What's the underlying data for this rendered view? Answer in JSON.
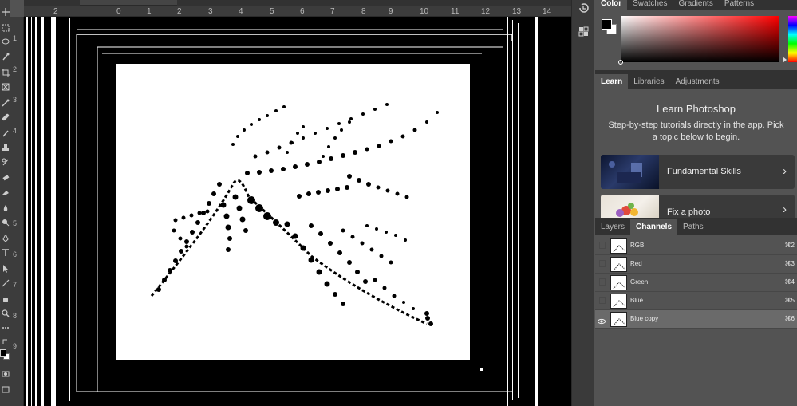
{
  "ruler_top": {
    "labels": [
      "2",
      "0",
      "1",
      "2",
      "3",
      "4",
      "5",
      "6",
      "7",
      "8",
      "9",
      "10",
      "11",
      "12",
      "13",
      "14"
    ]
  },
  "ruler_left": {
    "labels": [
      "1",
      "2",
      "3",
      "4",
      "5",
      "6",
      "7",
      "8",
      "9"
    ]
  },
  "color_panel": {
    "tabs": [
      "Color",
      "Swatches",
      "Gradients",
      "Patterns"
    ],
    "foreground": "#000000",
    "background": "#ffffff",
    "hue": "#ff0000"
  },
  "learn_panel": {
    "tabs": [
      "Learn",
      "Libraries",
      "Adjustments"
    ],
    "title": "Learn Photoshop",
    "description": "Step-by-step tutorials directly in the app. Pick a topic below to begin.",
    "tutorials": [
      {
        "label": "Fundamental Skills"
      },
      {
        "label": "Fix a photo"
      }
    ]
  },
  "channels_panel": {
    "tabs": [
      "Layers",
      "Channels",
      "Paths"
    ],
    "channels": [
      {
        "name": "RGB",
        "shortcut": "⌘2",
        "visible": false,
        "selected": false
      },
      {
        "name": "Red",
        "shortcut": "⌘3",
        "visible": false,
        "selected": false
      },
      {
        "name": "Green",
        "shortcut": "⌘4",
        "visible": false,
        "selected": false
      },
      {
        "name": "Blue",
        "shortcut": "⌘5",
        "visible": false,
        "selected": false
      },
      {
        "name": "Blue copy",
        "shortcut": "⌘6",
        "visible": true,
        "selected": true
      }
    ]
  },
  "icons": {
    "toolbar": [
      "move-icon",
      "marquee-icon",
      "lasso-icon",
      "quick-select-icon",
      "crop-icon",
      "frame-icon",
      "eyedropper-icon",
      "healing-icon",
      "brush-icon",
      "stamp-icon",
      "history-brush-icon",
      "eraser-icon",
      "gradient-icon",
      "blur-icon",
      "dodge-icon",
      "pen-icon",
      "type-icon",
      "path-select-icon",
      "line-icon",
      "hand-icon",
      "zoom-icon",
      "more-icon",
      "swap-icon",
      "quick-mask-icon",
      "screen-mode-icon"
    ],
    "side_strip": [
      "history-icon",
      "properties-icon"
    ]
  }
}
